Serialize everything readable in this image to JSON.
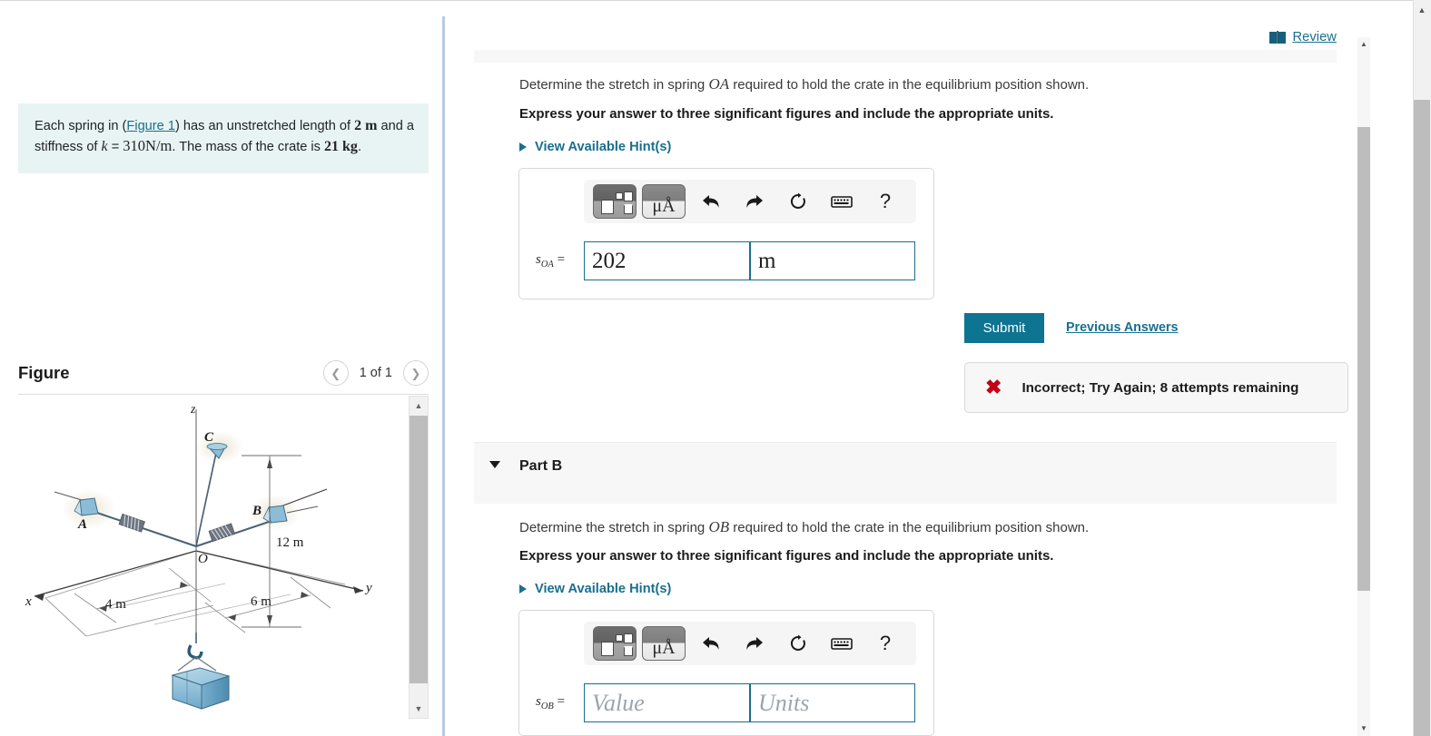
{
  "problem": {
    "text_before_link": "Each spring in (",
    "figure_link": "Figure 1",
    "text_after_link": ") has an unstretched length of ",
    "length_value": "2 m",
    "text_mid": " and a stiffness of ",
    "k_symbol": "k",
    "k_equals": " = ",
    "k_value": "310N/m",
    "text_mass": ". The mass of the crate is ",
    "mass_value": "21 kg",
    "period": "."
  },
  "figure": {
    "title": "Figure",
    "count_label": "1 of 1",
    "prev_icon": "chevron-left-icon",
    "next_icon": "chevron-right-icon",
    "labels": {
      "z": "z",
      "x": "x",
      "y": "y",
      "O": "O",
      "A": "A",
      "B": "B",
      "C": "C",
      "dim_12": "12 m",
      "dim_4": "4 m",
      "dim_6": "6 m"
    }
  },
  "review": {
    "icon": "book-icon",
    "label": "Review"
  },
  "partA": {
    "question": "Determine the stretch in spring ",
    "question_math": "OA",
    "question_rest": " required to hold the crate in the equilibrium position shown.",
    "instruction": "Express your answer to three significant figures and include the appropriate units.",
    "hints_label": "View Available Hint(s)",
    "answer_label_var": "s",
    "answer_label_sub": "OA",
    "answer_label_eq": " = ",
    "value": "202",
    "units": "m",
    "toolbar": {
      "template_icon": "math-template-icon",
      "units_icon": "micro-angstrom-icon",
      "units_icon_label": "μÅ",
      "undo_icon": "undo-icon",
      "redo_icon": "redo-icon",
      "reset_icon": "reset-icon",
      "keyboard_icon": "keyboard-icon",
      "help_icon": "help-icon",
      "help_label": "?"
    },
    "submit_label": "Submit",
    "previous_answers_label": "Previous Answers",
    "feedback_icon": "incorrect-x-icon",
    "feedback_text": "Incorrect; Try Again; 8 attempts remaining"
  },
  "partB": {
    "caret_icon": "caret-down-icon",
    "title": "Part B",
    "question": "Determine the stretch in spring ",
    "question_math": "OB",
    "question_rest": " required to hold the crate in the equilibrium position shown.",
    "instruction": "Express your answer to three significant figures and include the appropriate units.",
    "hints_label": "View Available Hint(s)",
    "answer_label_var": "s",
    "answer_label_sub": "OB",
    "answer_label_eq": " = ",
    "value_placeholder": "Value",
    "units_placeholder": "Units",
    "toolbar": {
      "template_icon": "math-template-icon",
      "units_icon_label": "μÅ",
      "help_label": "?"
    }
  },
  "colors": {
    "accent": "#1a6f8e",
    "submit": "#0d7491",
    "problem_bg": "#e8f4f4",
    "error": "#c00014",
    "band": "#f7f7f7"
  },
  "scrollbars": {
    "figure_up_icon": "scroll-up-icon",
    "figure_down_icon": "scroll-down-icon",
    "inner_up_icon": "scroll-up-icon",
    "inner_down_icon": "scroll-down-icon",
    "outer_up_icon": "scroll-up-icon"
  }
}
